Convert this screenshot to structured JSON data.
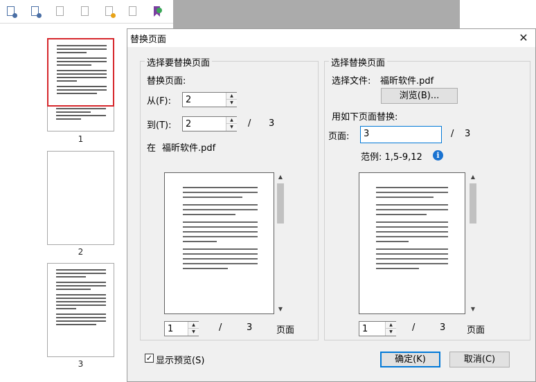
{
  "toolbar": {
    "icons": [
      "insert-page-icon",
      "extract-page-icon",
      "delete-page-icon",
      "move-page-icon",
      "replace-page-icon",
      "rotate-page-icon",
      "bookmark-icon"
    ]
  },
  "thumbnails": [
    {
      "page": "1"
    },
    {
      "page": "2"
    },
    {
      "page": "3"
    }
  ],
  "dialog": {
    "title": "替换页面",
    "close": "✕",
    "left_group": {
      "title": "选择要替换页面",
      "replace_pages_label": "替换页面:",
      "from_label": "从(F):",
      "from_value": "2",
      "to_label": "到(T):",
      "to_value": "2",
      "slash": "/",
      "total": "3",
      "in_label": "在",
      "file_name": "福昕软件.pdf",
      "pager_value": "1",
      "pager_slash": "/",
      "pager_total": "3",
      "pager_unit": "页面"
    },
    "right_group": {
      "title": "选择替换页面",
      "select_file_label": "选择文件:",
      "file_name": "福昕软件.pdf",
      "browse_button": "浏览(B)...",
      "use_pages_label": "用如下页面替换:",
      "page_label": "页面:",
      "page_value": "3",
      "slash": "/",
      "total": "3",
      "example_label": "范例: 1,5-9,12",
      "info_icon": "i",
      "pager_value": "1",
      "pager_slash": "/",
      "pager_total": "3",
      "pager_unit": "页面"
    },
    "show_preview_label": "显示预览(S)",
    "show_preview_checked": true,
    "ok_button": "确定(K)",
    "cancel_button": "取消(C)"
  },
  "colors": {
    "accent": "#0078d7",
    "selected_thumbnail": "#d6262b",
    "info": "#1a73d1"
  }
}
